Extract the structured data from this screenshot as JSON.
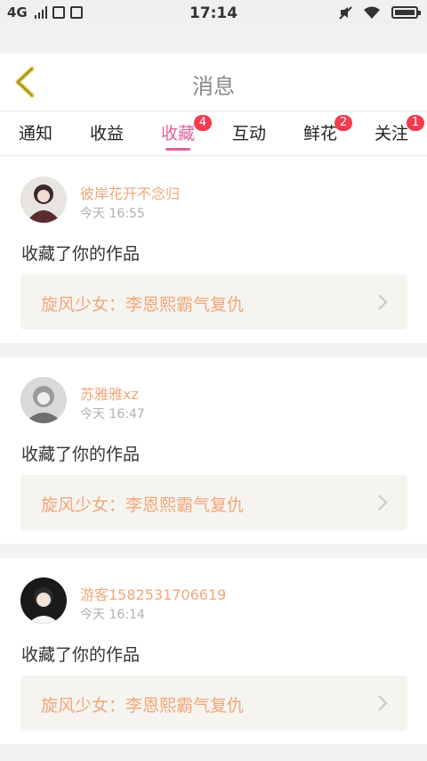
{
  "status_bar": {
    "network": "4G",
    "time": "17:14"
  },
  "header": {
    "title": "消息"
  },
  "tabs": [
    {
      "label": "通知",
      "badge": ""
    },
    {
      "label": "收益",
      "badge": ""
    },
    {
      "label": "收藏",
      "badge": "4",
      "active": true
    },
    {
      "label": "互动",
      "badge": ""
    },
    {
      "label": "鲜花",
      "badge": "2"
    },
    {
      "label": "关注",
      "badge": "1"
    }
  ],
  "notifications": [
    {
      "username": "彼岸花开不念归",
      "time": "今天 16:55",
      "message": "收藏了你的作品",
      "work_title": "旋风少女：李恩熙霸气复仇"
    },
    {
      "username": "苏雅雅xz",
      "time": "今天 16:47",
      "message": "收藏了你的作品",
      "work_title": "旋风少女：李恩熙霸气复仇"
    },
    {
      "username": "游客1582531706619",
      "time": "今天 16:14",
      "message": "收藏了你的作品",
      "work_title": "旋风少女：李恩熙霸气复仇"
    }
  ],
  "colors": {
    "accent": "#e0609b",
    "username": "#f0a77a",
    "badge": "#f03c4d",
    "back_arrow": "#e3c83a"
  }
}
